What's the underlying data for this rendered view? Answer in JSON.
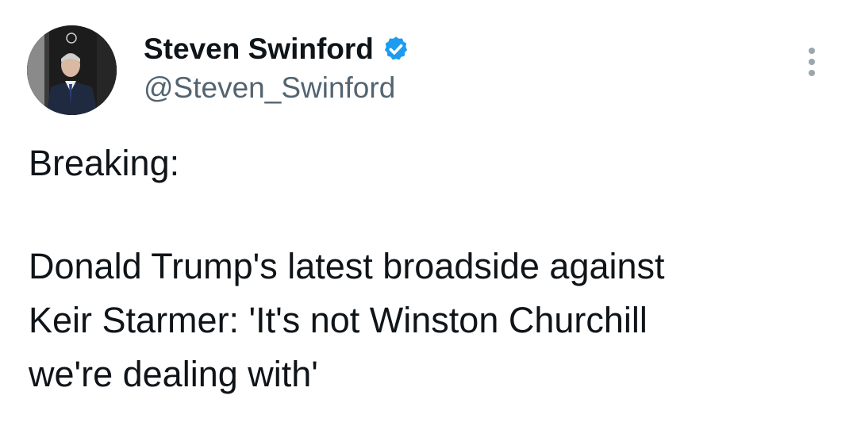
{
  "author": {
    "display_name": "Steven Swinford",
    "handle": "@Steven_Swinford",
    "verified": true,
    "avatar_alt": "profile photo"
  },
  "tweet": {
    "lines": [
      "Breaking:",
      "Donald Trump's latest broadside against",
      "Keir Starmer: 'It's not Winston Churchill",
      "we're dealing with'"
    ]
  },
  "icons": {
    "verified": "verified-badge-icon",
    "more": "more-options-icon"
  },
  "colors": {
    "text": "#0f1419",
    "secondary_text": "#536471",
    "verified_blue": "#1d9bf0",
    "background": "#ffffff"
  }
}
